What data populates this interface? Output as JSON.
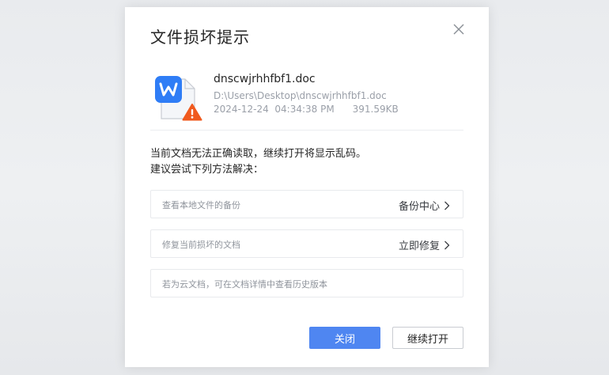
{
  "dialog": {
    "title": "文件损坏提示",
    "close_icon": "close-icon"
  },
  "file": {
    "icon": "wps-writer-doc-icon",
    "warning_icon": "warning-icon",
    "name": "dnscwjrhhfbf1.doc",
    "path": "D:\\Users\\Desktop\\dnscwjrhhfbf1.doc",
    "date": "2024-12-24",
    "time": "04:34:38 PM",
    "size": "391.59KB"
  },
  "message": {
    "line1": "当前文档无法正确读取，继续打开将显示乱码。",
    "line2": "建议尝试下列方法解决："
  },
  "options": [
    {
      "label": "查看本地文件的备份",
      "action": "备份中心"
    },
    {
      "label": "修复当前损坏的文档",
      "action": "立即修复"
    },
    {
      "label": "若为云文档，可在文档详情中查看历史版本",
      "action": ""
    }
  ],
  "buttons": {
    "close": "关闭",
    "continue": "继续打开"
  },
  "colors": {
    "primary": "#4f86f1",
    "warning": "#f05a1e",
    "doc_blue": "#2f7df6"
  }
}
